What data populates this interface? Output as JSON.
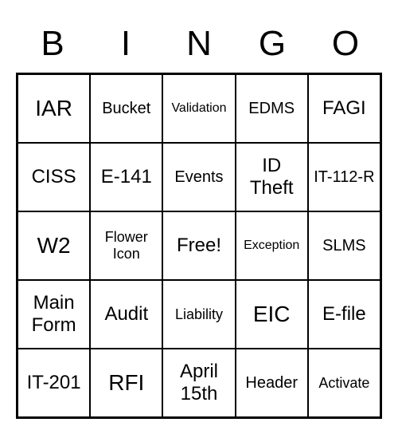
{
  "header": {
    "letters": [
      "B",
      "I",
      "N",
      "G",
      "O"
    ]
  },
  "cells": [
    {
      "text": "IAR",
      "size": "xl"
    },
    {
      "text": "Bucket",
      "size": "m"
    },
    {
      "text": "Validation",
      "size": "xs"
    },
    {
      "text": "EDMS",
      "size": "m"
    },
    {
      "text": "FAGI",
      "size": "l"
    },
    {
      "text": "CISS",
      "size": "l"
    },
    {
      "text": "E-141",
      "size": "l"
    },
    {
      "text": "Events",
      "size": "m"
    },
    {
      "text": "ID Theft",
      "size": "l"
    },
    {
      "text": "IT-112-R",
      "size": "m"
    },
    {
      "text": "W2",
      "size": "xl"
    },
    {
      "text": "Flower Icon",
      "size": "s"
    },
    {
      "text": "Free!",
      "size": "l"
    },
    {
      "text": "Exception",
      "size": "xs"
    },
    {
      "text": "SLMS",
      "size": "m"
    },
    {
      "text": "Main Form",
      "size": "l"
    },
    {
      "text": "Audit",
      "size": "l"
    },
    {
      "text": "Liability",
      "size": "s"
    },
    {
      "text": "EIC",
      "size": "xl"
    },
    {
      "text": "E-file",
      "size": "l"
    },
    {
      "text": "IT-201",
      "size": "l"
    },
    {
      "text": "RFI",
      "size": "xl"
    },
    {
      "text": "April 15th",
      "size": "l"
    },
    {
      "text": "Header",
      "size": "m"
    },
    {
      "text": "Activate",
      "size": "s"
    }
  ],
  "chart_data": {
    "type": "table",
    "title": "BINGO",
    "columns": [
      "B",
      "I",
      "N",
      "G",
      "O"
    ],
    "rows": [
      [
        "IAR",
        "Bucket",
        "Validation",
        "EDMS",
        "FAGI"
      ],
      [
        "CISS",
        "E-141",
        "Events",
        "ID Theft",
        "IT-112-R"
      ],
      [
        "W2",
        "Flower Icon",
        "Free!",
        "Exception",
        "SLMS"
      ],
      [
        "Main Form",
        "Audit",
        "Liability",
        "EIC",
        "E-file"
      ],
      [
        "IT-201",
        "RFI",
        "April 15th",
        "Header",
        "Activate"
      ]
    ]
  }
}
